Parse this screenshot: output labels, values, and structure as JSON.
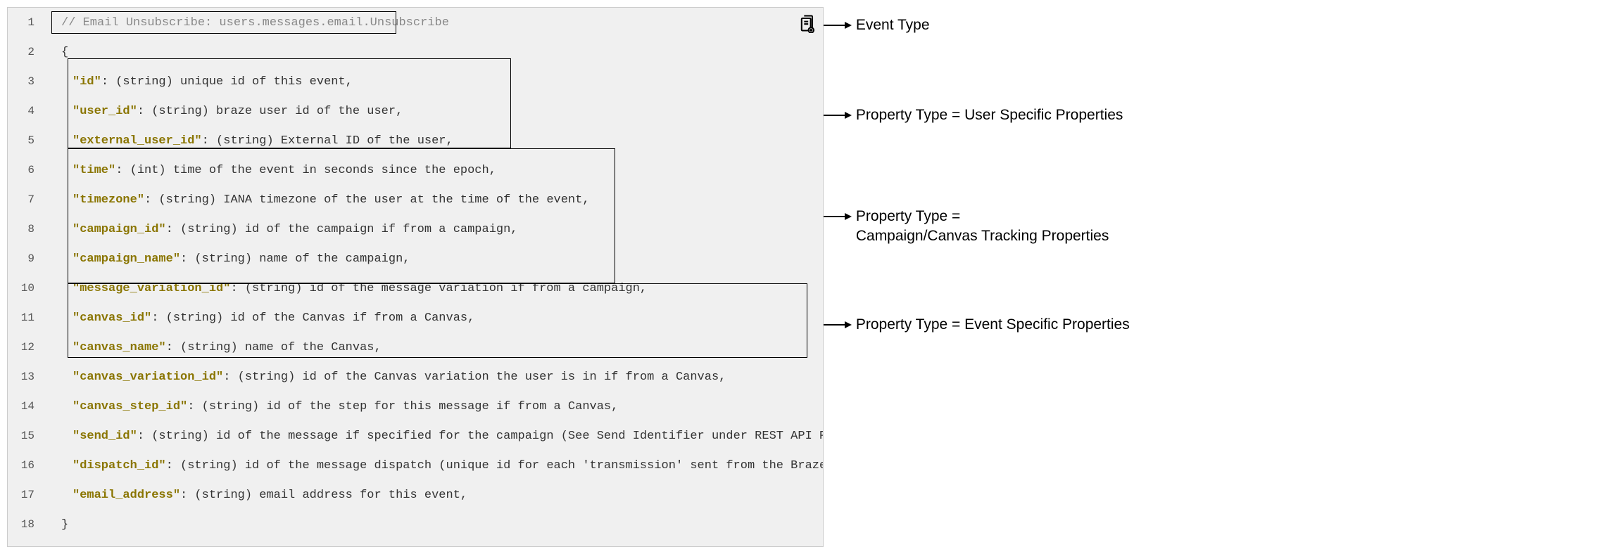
{
  "code": {
    "lines": [
      {
        "num": "1",
        "indent": 1,
        "kind": "comment",
        "text": "// Email Unsubscribe: users.messages.email.Unsubscribe"
      },
      {
        "num": "2",
        "indent": 1,
        "kind": "plain",
        "text": "{"
      },
      {
        "num": "3",
        "indent": 2,
        "kind": "prop",
        "key": "\"id\"",
        "rest": ": (string) unique id of this event,"
      },
      {
        "num": "4",
        "indent": 2,
        "kind": "prop",
        "key": "\"user_id\"",
        "rest": ": (string) braze user id of the user,"
      },
      {
        "num": "5",
        "indent": 2,
        "kind": "prop",
        "key": "\"external_user_id\"",
        "rest": ": (string) External ID of the user,"
      },
      {
        "num": "6",
        "indent": 2,
        "kind": "prop",
        "key": "\"time\"",
        "rest": ": (int) time of the event in seconds since the epoch,"
      },
      {
        "num": "7",
        "indent": 2,
        "kind": "prop",
        "key": "\"timezone\"",
        "rest": ": (string) IANA timezone of the user at the time of the event,"
      },
      {
        "num": "8",
        "indent": 2,
        "kind": "prop",
        "key": "\"campaign_id\"",
        "rest": ": (string) id of the campaign if from a campaign,"
      },
      {
        "num": "9",
        "indent": 2,
        "kind": "prop",
        "key": "\"campaign_name\"",
        "rest": ": (string) name of the campaign,"
      },
      {
        "num": "10",
        "indent": 2,
        "kind": "prop",
        "key": "\"message_variation_id\"",
        "rest": ": (string) id of the message variation if from a campaign,"
      },
      {
        "num": "11",
        "indent": 2,
        "kind": "prop",
        "key": "\"canvas_id\"",
        "rest": ": (string) id of the Canvas if from a Canvas,"
      },
      {
        "num": "12",
        "indent": 2,
        "kind": "prop",
        "key": "\"canvas_name\"",
        "rest": ": (string) name of the Canvas,"
      },
      {
        "num": "13",
        "indent": 2,
        "kind": "prop",
        "key": "\"canvas_variation_id\"",
        "rest": ": (string) id of the Canvas variation the user is in if from a Canvas,"
      },
      {
        "num": "14",
        "indent": 2,
        "kind": "prop",
        "key": "\"canvas_step_id\"",
        "rest": ": (string) id of the step for this message if from a Canvas,"
      },
      {
        "num": "15",
        "indent": 2,
        "kind": "prop",
        "key": "\"send_id\"",
        "rest": ": (string) id of the message if specified for the campaign (See Send Identifier under REST API Parameter Definition"
      },
      {
        "num": "16",
        "indent": 2,
        "kind": "prop",
        "key": "\"dispatch_id\"",
        "rest": ": (string) id of the message dispatch (unique id for each 'transmission' sent from the Braze platform). Users w"
      },
      {
        "num": "17",
        "indent": 2,
        "kind": "prop",
        "key": "\"email_address\"",
        "rest": ": (string) email address for this event,"
      },
      {
        "num": "18",
        "indent": 1,
        "kind": "plain",
        "text": "}"
      }
    ]
  },
  "annotations": {
    "event": "Event Type",
    "user": "Property Type = User Specific Properties",
    "campaign1": "Property Type =",
    "campaign2": "Campaign/Canvas Tracking Properties",
    "specific": "Property Type = Event Specific Properties"
  }
}
